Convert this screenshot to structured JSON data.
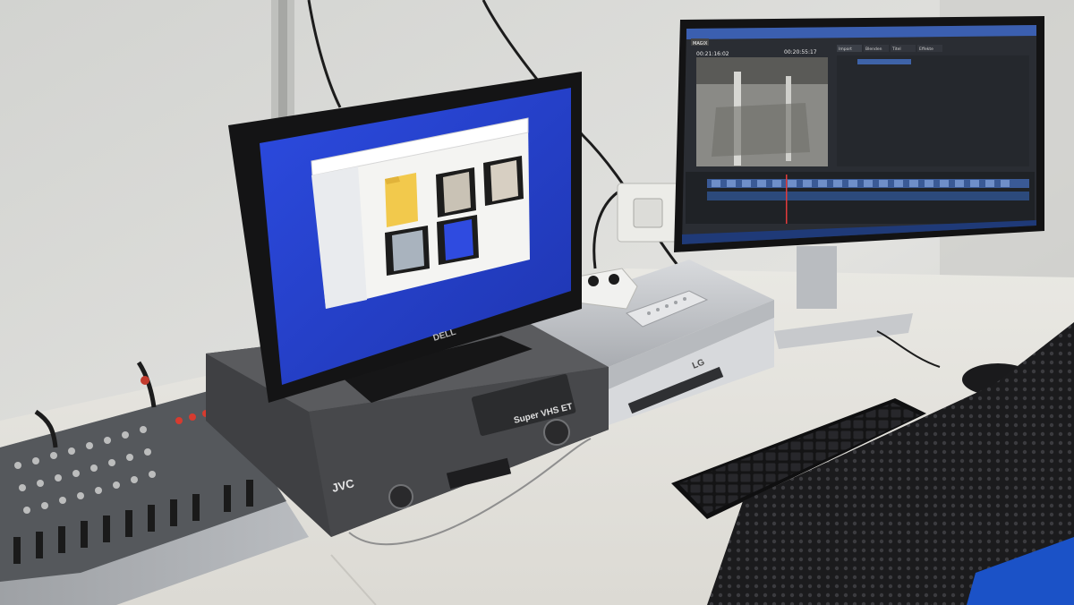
{
  "scene": {
    "description_kind": "photo",
    "colors": {
      "wall": "#dcdcd8",
      "desk": "#ebe9e4",
      "win_blue": "#2440c8",
      "editor_bg": "#2a2d33",
      "vcr_body": "#4a4b4e",
      "dvd_silver": "#c9cbcf"
    }
  },
  "monitor_left": {
    "brand": "DELL",
    "window": {
      "folders": [
        {
          "icon": "folder-icon"
        },
        {
          "icon": "video-thumb-icon"
        },
        {
          "icon": "video-thumb-icon"
        },
        {
          "icon": "video-thumb-icon"
        },
        {
          "icon": "video-thumb-icon"
        }
      ]
    }
  },
  "monitor_right": {
    "app_badge": "MAGIX",
    "tabs": [
      "Import",
      "Blenden",
      "Titel",
      "Effekte"
    ],
    "timecode_left": "00:21:16:02",
    "timecode_right": "00:20:55:17"
  },
  "vcr": {
    "brand": "JVC",
    "format": "Super VHS ET"
  },
  "dvd_recorder": {
    "brand": "LG"
  }
}
